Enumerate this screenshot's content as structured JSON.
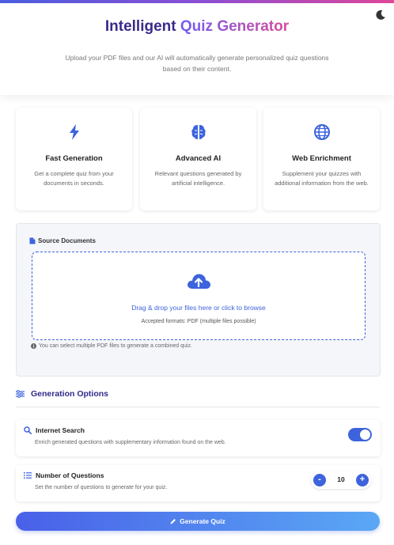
{
  "header": {
    "title_part1": "Intelligent",
    "title_part2": "Quiz Generator",
    "subtitle": "Upload your PDF files and our AI will automatically generate personalized quiz questions based on their content.",
    "theme_icon": "moon-icon"
  },
  "features": [
    {
      "icon": "bolt-icon",
      "title": "Fast Generation",
      "desc": "Get a complete quiz from your documents in seconds."
    },
    {
      "icon": "brain-icon",
      "title": "Advanced AI",
      "desc": "Relevant questions generated by artificial intelligence."
    },
    {
      "icon": "globe-icon",
      "title": "Web Enrichment",
      "desc": "Supplement your quizzes with additional information from the web."
    }
  ],
  "source": {
    "label": "Source Documents",
    "drop_text": "Drag & drop your files here or click to browse",
    "formats": "Accepted formats: PDF (multiple files possible)",
    "hint": "You can select multiple PDF files to generate a combined quiz."
  },
  "options": {
    "heading": "Generation Options",
    "internet_search": {
      "title": "Internet Search",
      "desc": "Enrich generated questions with supplementary information found on the web.",
      "enabled": true
    },
    "num_questions": {
      "title": "Number of Questions",
      "desc": "Set the number of questions to generate for your quiz.",
      "value": "10",
      "minus": "-",
      "plus": "+"
    }
  },
  "generate_label": "Generate Quiz",
  "colors": {
    "accent": "#3d63dd",
    "title_dark": "#3b2a8a",
    "gradient_start": "#6f5ef0",
    "gradient_end": "#d84a9c"
  }
}
